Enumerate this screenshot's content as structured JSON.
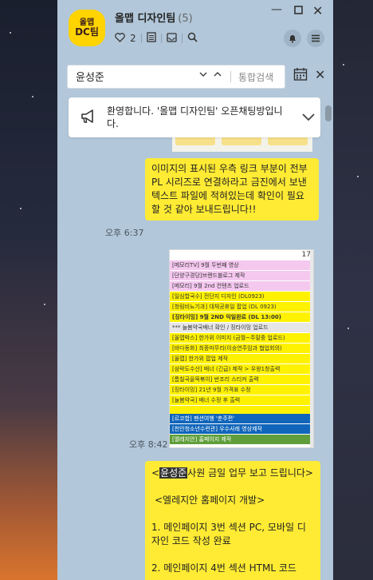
{
  "header": {
    "avatar_line1": "올맵",
    "avatar_line2": "DC팀",
    "title": "올맵 디자인팀",
    "member_count": "(5)",
    "like_count": "2"
  },
  "search": {
    "value": "윤성준",
    "total_search_label": "통합검색"
  },
  "notice": {
    "text": "환영합니다. '올맵 디자인팀' 오픈채팅방입니다."
  },
  "messages": [
    {
      "text": "이미지의 표시된 우측 링크 부분이 전부 PL 시리즈로 연결하라고 금진에서 보낸 텍스트 파일에 적혀있는데 확인이 필요 할 것 같아 보내드립니다!!",
      "time": "오후 6:37"
    },
    {
      "time": "오후 8:42"
    },
    {
      "highlight": "윤성준",
      "text_after_highlight": "사원 금일 업무 보고 드립니다>",
      "section": "<엘레지안 홈페이지 개발>",
      "item1": "1. 메인페이지 3번 섹션 PC, 모바일 디자인 코드 작성 완료",
      "item2": "2. 메인페이지 4번 섹션 HTML 코드"
    }
  ],
  "sheet": {
    "page_number": "17",
    "rows": [
      "[메모리TV] 9월 두번째 영상",
      "[단양구경당]브랜드블로그 제작",
      "[메모리] 9월 2nd 컨텐츠 업로드",
      "[일심합국수] 전단지 디자인 (DL0923)",
      "[청림비뇨기과] 대체공휴일 팝업 (DL 0923)",
      "[징타이밍] 9월 2ND 익일완료 (DL 13:00)",
      "*** 늘봄약국배너 확인 / 징타이밍 업로드",
      "[올맵박스] 한가위 이미지 (금월~주말중 업로드)",
      "[바다동화] 최종마무리(이승연주임과 협업회의)",
      "[올맵] 한가위 팝업 제작",
      "[삼락도수산] 배너 (긴급) 제작 > 우왕1창출력",
      "[틈칠국을뚝볶이] 반조리 스티커 출력",
      "[징타이밍] 21년 9월 가격표 수정",
      "[늘봄약국] 배너 수정 후 출력",
      "[르코합] 팬션여행 '춘주편'",
      "[천안청소년수련관] 우수사례 영상제작",
      "[엘레지안] 홈페이지 제작"
    ]
  },
  "colors": {
    "chat_bg": "#b2c7d9",
    "bubble": "#ffeb33",
    "avatar": "#ffd400"
  },
  "icons": [
    "heart-icon",
    "list-icon",
    "inbox-icon",
    "search-icon",
    "bell-icon",
    "menu-icon",
    "calendar-icon",
    "megaphone-icon",
    "chevron-down-icon",
    "close-icon"
  ]
}
